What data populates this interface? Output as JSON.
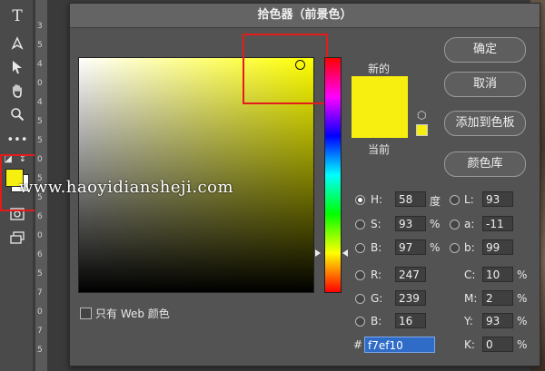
{
  "dialog": {
    "title": "拾色器（前景色）",
    "new_label": "新的",
    "current_label": "当前",
    "buttons": {
      "ok": "确定",
      "cancel": "取消",
      "add_to_swatches": "添加到色板",
      "color_libraries": "颜色库"
    },
    "web_only_label": "只有 Web 颜色",
    "color": {
      "hex_swatch": "#f7ef10"
    },
    "hsb": {
      "h": {
        "label": "H:",
        "value": "58",
        "unit": "度"
      },
      "s": {
        "label": "S:",
        "value": "93",
        "unit": "%"
      },
      "b": {
        "label": "B:",
        "value": "97",
        "unit": "%"
      }
    },
    "rgb": {
      "r": {
        "label": "R:",
        "value": "247"
      },
      "g": {
        "label": "G:",
        "value": "239"
      },
      "b": {
        "label": "B:",
        "value": "16"
      }
    },
    "lab": {
      "l": {
        "label": "L:",
        "value": "93"
      },
      "a": {
        "label": "a:",
        "value": "-11"
      },
      "b": {
        "label": "b:",
        "value": "99"
      }
    },
    "cmyk": {
      "c": {
        "label": "C:",
        "value": "10",
        "unit": "%"
      },
      "m": {
        "label": "M:",
        "value": "2",
        "unit": "%"
      },
      "y": {
        "label": "Y:",
        "value": "93",
        "unit": "%"
      },
      "k": {
        "label": "K:",
        "value": "0",
        "unit": "%"
      }
    },
    "hex": {
      "label": "#",
      "value": "f7ef10"
    }
  },
  "ruler_numbers": [
    "3",
    "5",
    "4",
    "0",
    "4",
    "5",
    "5",
    "0",
    "5",
    "5",
    "6",
    "0",
    "6",
    "5",
    "7",
    "0",
    "7",
    "5"
  ],
  "watermark": "www.haoyidiansheji.com",
  "toolbar": {
    "icons": [
      "type-tool-icon",
      "pen-tool-icon",
      "path-selection-icon",
      "hand-tool-icon",
      "zoom-tool-icon",
      "more-tools-icon",
      "quick-mask-icon",
      "screen-mode-icon"
    ]
  },
  "colors": {
    "accent_red": "#e41b1b",
    "selection_blue": "#2f6cc8"
  }
}
